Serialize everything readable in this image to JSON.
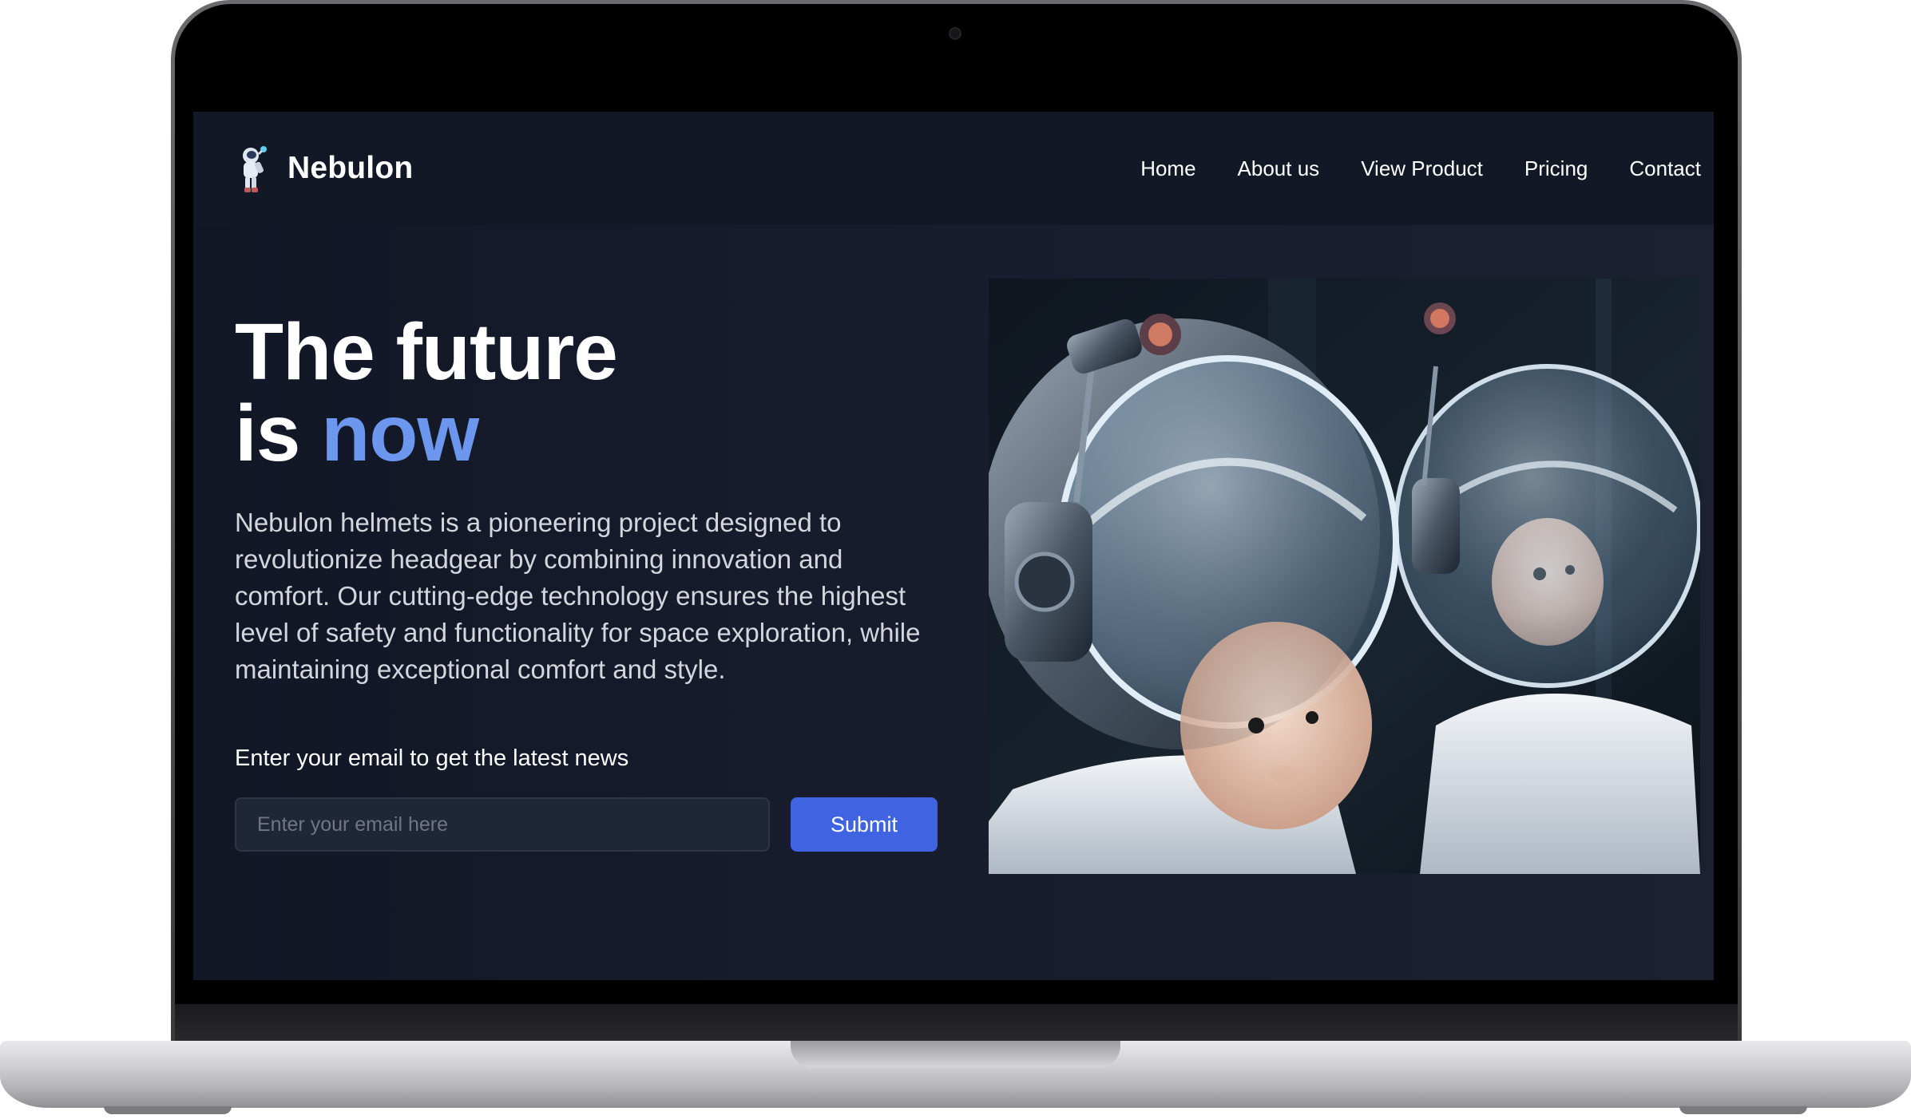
{
  "brand": {
    "name": "Nebulon",
    "logo_icon": "astronaut-icon"
  },
  "nav": {
    "items": [
      {
        "label": "Home"
      },
      {
        "label": "About us"
      },
      {
        "label": "View Product"
      },
      {
        "label": "Pricing"
      },
      {
        "label": "Contact"
      }
    ]
  },
  "hero": {
    "headline_line1": "The future",
    "headline_line2_prefix": "is ",
    "headline_line2_accent": "now",
    "description": "Nebulon helmets is a pioneering project designed to revolutionize headgear by combining innovation and comfort. Our cutting-edge technology ensures the highest level of safety and functionality for space exploration, while maintaining exceptional comfort and style.",
    "email_label": "Enter your email to get the latest news",
    "email_placeholder": "Enter your email here",
    "submit_label": "Submit",
    "image_icon": "astronaut-babies-image"
  },
  "colors": {
    "accent": "#6d97ee",
    "button": "#3f63e1",
    "background": "#161c2c",
    "navbar": "#131826"
  }
}
